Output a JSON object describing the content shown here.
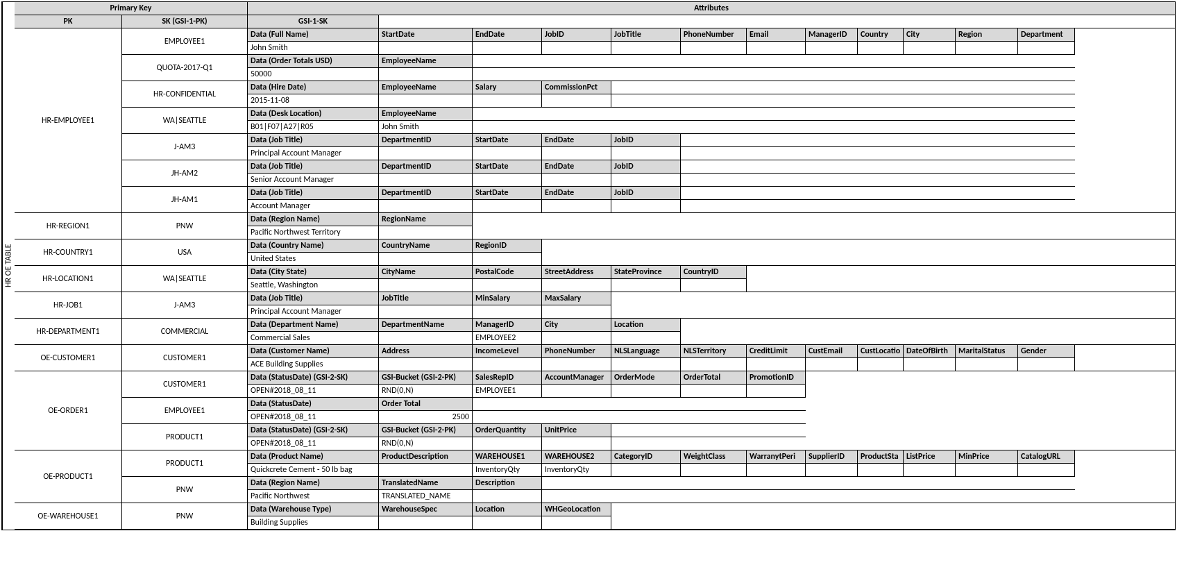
{
  "tableLabel": "HR OE TABLE",
  "topHeaders": {
    "pk": "Primary Key",
    "attr": "Attributes"
  },
  "colHeaders": {
    "pk": "PK",
    "sk": "SK (GSI-1-PK)",
    "gsi": "GSI-1-SK"
  },
  "blocks": [
    {
      "pk": "HR-EMPLOYEE1",
      "groups": [
        {
          "sk": "EMPLOYEE1",
          "h": [
            "Data (Full Name)",
            "StartDate",
            "EndDate",
            "JobID",
            "JobTitle",
            "PhoneNumber",
            "Email",
            "ManagerID",
            "Country",
            "City",
            "Region",
            "Department"
          ],
          "v": [
            "John Smith",
            "",
            "",
            "",
            "",
            "",
            "",
            "",
            "",
            "",
            "",
            ""
          ]
        },
        {
          "sk": "QUOTA-2017-Q1",
          "h": [
            "Data (Order Totals USD)",
            "EmployeeName"
          ],
          "v": [
            "50000",
            ""
          ]
        },
        {
          "sk": "HR-CONFIDENTIAL",
          "h": [
            "Data (Hire Date)",
            "EmployeeName",
            "Salary",
            "CommissionPct"
          ],
          "v": [
            "2015-11-08",
            "",
            "",
            ""
          ]
        },
        {
          "sk": "WA|SEATTLE",
          "h": [
            "Data (Desk Location)",
            "EmployeeName"
          ],
          "v": [
            "B01|F07|A27|R05",
            "John Smith"
          ]
        },
        {
          "sk": "J-AM3",
          "h": [
            "Data (Job Title)",
            "DepartmentID",
            "StartDate",
            "EndDate",
            "JobID"
          ],
          "v": [
            "Principal Account Manager",
            "",
            "",
            "",
            ""
          ]
        },
        {
          "sk": "JH-AM2",
          "h": [
            "Data (Job Title)",
            "DepartmentID",
            "StartDate",
            "EndDate",
            "JobID"
          ],
          "v": [
            "Senior Account Manager",
            "",
            "",
            "",
            ""
          ]
        },
        {
          "sk": "JH-AM1",
          "h": [
            "Data (Job Title)",
            "DepartmentID",
            "StartDate",
            "EndDate",
            "JobID"
          ],
          "v": [
            "Account Manager",
            "",
            "",
            "",
            ""
          ]
        }
      ]
    },
    {
      "pk": "HR-REGION1",
      "groups": [
        {
          "sk": "PNW",
          "h": [
            "Data (Region Name)",
            "RegionName"
          ],
          "v": [
            "Pacific Northwest Territory",
            ""
          ]
        }
      ]
    },
    {
      "pk": "HR-COUNTRY1",
      "groups": [
        {
          "sk": "USA",
          "h": [
            "Data (Country Name)",
            "CountryName",
            "RegionID"
          ],
          "v": [
            "United States",
            "",
            ""
          ]
        }
      ]
    },
    {
      "pk": "HR-LOCATION1",
      "groups": [
        {
          "sk": "WA|SEATTLE",
          "h": [
            "Data (City State)",
            "CityName",
            "PostalCode",
            "StreetAddress",
            "StateProvince",
            "CountryID"
          ],
          "v": [
            "Seattle, Washington",
            "",
            "",
            "",
            "",
            ""
          ]
        }
      ]
    },
    {
      "pk": "HR-JOB1",
      "groups": [
        {
          "sk": "J-AM3",
          "h": [
            "Data (Job Title)",
            "JobTitle",
            "MinSalary",
            "MaxSalary"
          ],
          "v": [
            "Principal Account Manager",
            "",
            "",
            ""
          ]
        }
      ]
    },
    {
      "pk": "HR-DEPARTMENT1",
      "groups": [
        {
          "sk": "COMMERCIAL",
          "h": [
            "Data (Department Name)",
            "DepartmentName",
            "ManagerID",
            "City",
            "Location"
          ],
          "v": [
            "Commercial Sales",
            "",
            "EMPLOYEE2",
            "",
            ""
          ]
        }
      ]
    },
    {
      "pk": "OE-CUSTOMER1",
      "groups": [
        {
          "sk": "CUSTOMER1",
          "h": [
            "Data (Customer Name)",
            "Address",
            "IncomeLevel",
            "PhoneNumber",
            "NLSLanguage",
            "NLSTerritory",
            "CreditLimit",
            "CustEmail",
            "CustLocatio",
            "DateOfBirth",
            "MaritalStatus",
            "Gender"
          ],
          "v": [
            "ACE Building Supplies",
            "",
            "",
            "",
            "",
            "",
            "",
            "",
            "",
            "",
            "",
            ""
          ]
        }
      ]
    },
    {
      "pk": "OE-ORDER1",
      "groups": [
        {
          "sk": "CUSTOMER1",
          "h": [
            "Data (StatusDate) (GSI-2-SK)",
            "GSI-Bucket (GSI-2-PK)",
            "SalesRepID",
            "AccountManager",
            "OrderMode",
            "OrderTotal",
            "PromotionID"
          ],
          "v": [
            "OPEN#2018_08_11",
            "RND(0,N)",
            "EMPLOYEE1",
            "",
            "",
            "",
            ""
          ]
        },
        {
          "sk": "EMPLOYEE1",
          "h": [
            "Data (StatusDate)",
            "Order Total"
          ],
          "v": [
            "OPEN#2018_08_11",
            "2500"
          ],
          "num": [
            false,
            true
          ]
        },
        {
          "sk": "PRODUCT1",
          "h": [
            "Data (StatusDate) (GSI-2-SK)",
            "GSI-Bucket (GSI-2-PK)",
            "OrderQuantity",
            "UnitPrice"
          ],
          "v": [
            "OPEN#2018_08_11",
            "RND(0,N)",
            "",
            ""
          ]
        }
      ]
    },
    {
      "pk": "OE-PRODUCT1",
      "groups": [
        {
          "sk": "PRODUCT1",
          "h": [
            "Data (Product Name)",
            "ProductDescription",
            "WAREHOUSE1",
            "WAREHOUSE2",
            "CategoryID",
            "WeightClass",
            "WarranytPeri",
            "SupplierID",
            "ProductSta",
            "ListPrice",
            "MinPrice",
            "CatalogURL"
          ],
          "v": [
            "Quickcrete Cement - 50 lb bag",
            "",
            "InventoryQty",
            "InventoryQty",
            "",
            "",
            "",
            "",
            "",
            "",
            "",
            ""
          ]
        },
        {
          "sk": "PNW",
          "h": [
            "Data (Region Name)",
            "TranslatedName",
            "Description"
          ],
          "v": [
            "Pacific Northwest",
            "TRANSLATED_NAME",
            ""
          ]
        }
      ]
    },
    {
      "pk": "OE-WAREHOUSE1",
      "groups": [
        {
          "sk": "PNW",
          "h": [
            "Data (Warehouse Type)",
            "WarehouseSpec",
            "Location",
            "WHGeoLocation"
          ],
          "v": [
            "Building Supplies",
            "",
            "",
            ""
          ]
        }
      ]
    }
  ]
}
